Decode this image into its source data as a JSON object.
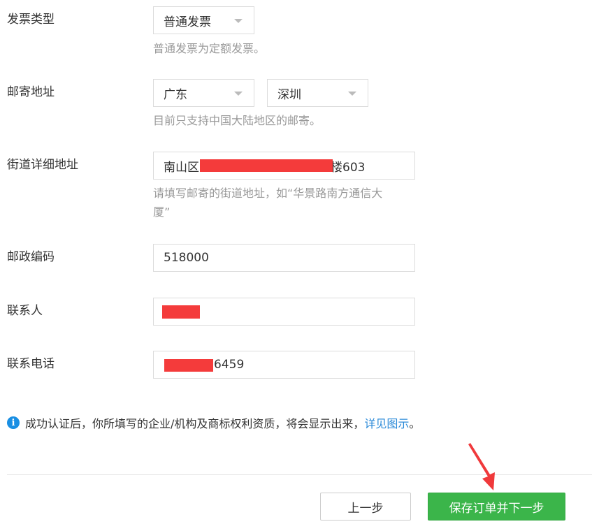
{
  "invoice": {
    "label": "发票类型",
    "selected": "普通发票",
    "hint": "普通发票为定额发票。"
  },
  "address": {
    "label": "邮寄地址",
    "province": "广东",
    "city": "深圳",
    "hint": "目前只支持中国大陆地区的邮寄。"
  },
  "street": {
    "label": "街道详细地址",
    "value_prefix": "南山区",
    "value_suffix": "楼603",
    "hint_line1": "请填写邮寄的街道地址，如“华景路南方通信大",
    "hint_line2": "厦”"
  },
  "postcode": {
    "label": "邮政编码",
    "value": "518000"
  },
  "contact": {
    "label": "联系人"
  },
  "phone": {
    "label": "联系电话",
    "value_suffix": "6459"
  },
  "notice": {
    "text": "成功认证后，你所填写的企业/机构及商标权利资质，将会显示出来，",
    "link": "详见图示",
    "end": "。",
    "icon": "info-icon"
  },
  "buttons": {
    "prev": "上一步",
    "save": "保存订单并下一步"
  },
  "colors": {
    "accent_green": "#3bb54a",
    "link_blue": "#2b8ad8",
    "redaction_red": "#f43b3b",
    "annotation_arrow_red": "#f0393b"
  }
}
